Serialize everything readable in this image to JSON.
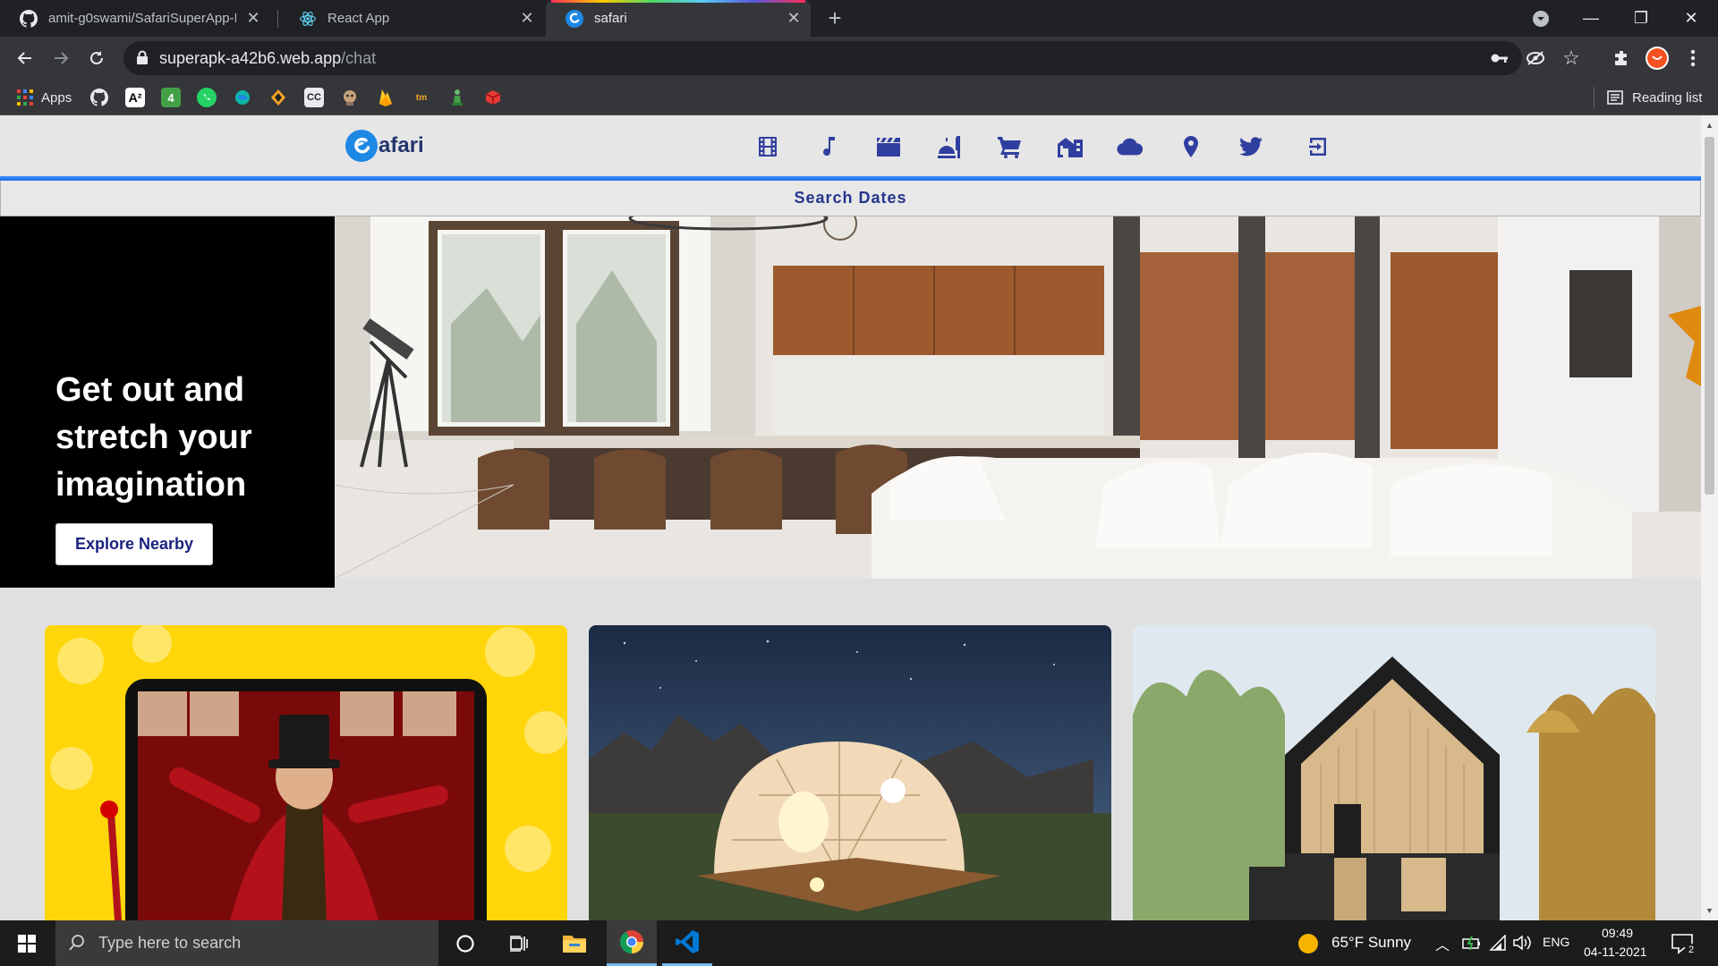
{
  "browser": {
    "tabs": [
      {
        "title": "amit-g0swami/SafariSuperApp-R",
        "icon": "github-icon",
        "active": false
      },
      {
        "title": "React App",
        "icon": "react-icon",
        "active": false
      },
      {
        "title": "safari",
        "icon": "safari-logo-icon",
        "active": true
      }
    ],
    "address": {
      "domain": "superapk-a42b6.web.app",
      "path": "/chat"
    },
    "bookmarks_apps_label": "Apps",
    "reading_list_label": "Reading list"
  },
  "app": {
    "logo_text": "afari",
    "nav_icons": [
      "film-icon",
      "music-note-icon",
      "clapperboard-icon",
      "food-service-icon",
      "shopping-cart-icon",
      "buildings-icon",
      "cloud-icon",
      "location-pin-icon",
      "twitter-icon",
      "logout-icon"
    ],
    "search_label": "Search Dates",
    "hero": {
      "heading": "Get out and stretch your imagination",
      "button_label": "Explore Nearby"
    }
  },
  "taskbar": {
    "search_placeholder": "Type here to search",
    "weather": "65°F  Sunny",
    "language": "ENG",
    "time": "09:49",
    "date": "04-11-2021",
    "notification_count": "2"
  },
  "colors": {
    "accent_blue": "#1e6be0",
    "brand_navy": "#24356e",
    "nav_icon": "#303f9f"
  }
}
